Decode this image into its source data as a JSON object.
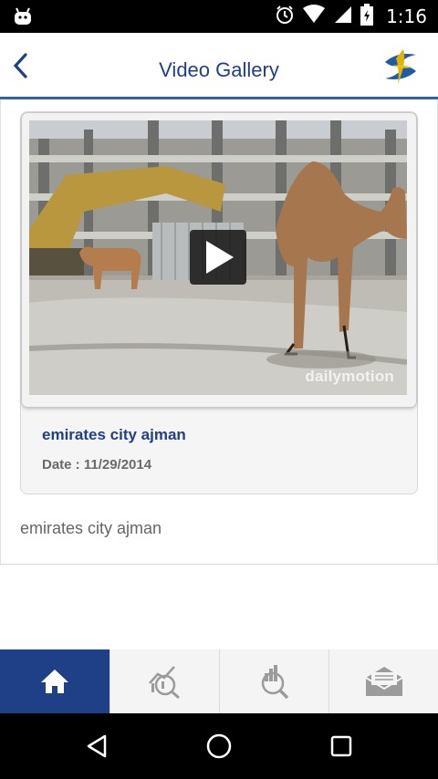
{
  "status_bar": {
    "time": "1:16",
    "icons": [
      "android-icon",
      "alarm-icon",
      "wifi-icon",
      "signal-icon",
      "battery-icon"
    ]
  },
  "header": {
    "title": "Video Gallery",
    "back_icon": "chevron-left-icon",
    "logo": "app-logo",
    "accent_color": "#2d66a8",
    "title_color": "#1f3f86"
  },
  "video": {
    "title": "emirates city ajman",
    "date": "Date : 11/29/2014",
    "watermark": "dailymotion",
    "play_icon": "play-icon"
  },
  "description": "emirates city ajman",
  "bottom_nav": {
    "active_color": "#1f3f86",
    "items": [
      {
        "icon": "home-icon",
        "active": true
      },
      {
        "icon": "chart-search-icon",
        "active": false
      },
      {
        "icon": "property-search-icon",
        "active": false
      },
      {
        "icon": "mail-icon",
        "active": false
      }
    ]
  },
  "system_nav": {
    "items": [
      "back-triangle-icon",
      "home-circle-icon",
      "recents-square-icon"
    ]
  }
}
